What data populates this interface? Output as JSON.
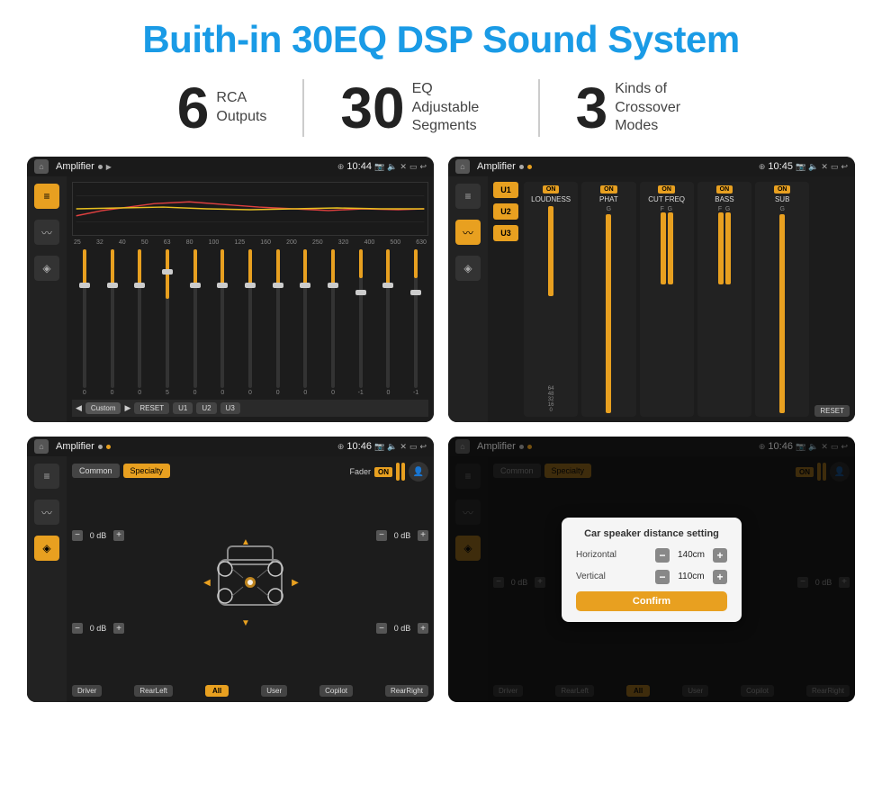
{
  "title": "Buith-in 30EQ DSP Sound System",
  "stats": [
    {
      "number": "6",
      "label_line1": "RCA",
      "label_line2": "Outputs"
    },
    {
      "number": "30",
      "label_line1": "EQ Adjustable",
      "label_line2": "Segments"
    },
    {
      "number": "3",
      "label_line1": "Kinds of",
      "label_line2": "Crossover Modes"
    }
  ],
  "screens": {
    "eq_screen": {
      "app_name": "Amplifier",
      "time": "10:44",
      "freq_labels": [
        "25",
        "32",
        "40",
        "50",
        "63",
        "80",
        "100",
        "125",
        "160",
        "200",
        "250",
        "320",
        "400",
        "500",
        "630"
      ],
      "slider_values": [
        "0",
        "0",
        "0",
        "5",
        "0",
        "0",
        "0",
        "0",
        "0",
        "0",
        "-1",
        "0",
        "-1"
      ],
      "bottom_buttons": [
        "Custom",
        "RESET",
        "U1",
        "U2",
        "U3"
      ]
    },
    "crossover_screen": {
      "app_name": "Amplifier",
      "time": "10:45",
      "u_buttons": [
        "U1",
        "U2",
        "U3"
      ],
      "channels": [
        {
          "on": true,
          "name": "LOUDNESS"
        },
        {
          "on": true,
          "name": "PHAT"
        },
        {
          "on": true,
          "name": "CUT FREQ"
        },
        {
          "on": true,
          "name": "BASS"
        },
        {
          "on": true,
          "name": "SUB"
        }
      ],
      "reset_label": "RESET"
    },
    "fader_screen": {
      "app_name": "Amplifier",
      "time": "10:46",
      "tabs": [
        "Common",
        "Specialty"
      ],
      "fader_label": "Fader",
      "on_badge": "ON",
      "db_values": [
        "0 dB",
        "0 dB",
        "0 dB",
        "0 dB"
      ],
      "bottom_buttons": [
        "Driver",
        "RearLeft",
        "All",
        "User",
        "Copilot",
        "RearRight"
      ]
    },
    "dialog_screen": {
      "app_name": "Amplifier",
      "time": "10:46",
      "tabs": [
        "Common",
        "Specialty"
      ],
      "on_badge": "ON",
      "dialog": {
        "title": "Car speaker distance setting",
        "fields": [
          {
            "label": "Horizontal",
            "value": "140cm"
          },
          {
            "label": "Vertical",
            "value": "110cm"
          }
        ],
        "confirm_label": "Confirm"
      },
      "bottom_buttons": [
        "Driver",
        "RearLeft",
        "All",
        "User",
        "Copilot",
        "RearRight"
      ]
    }
  }
}
